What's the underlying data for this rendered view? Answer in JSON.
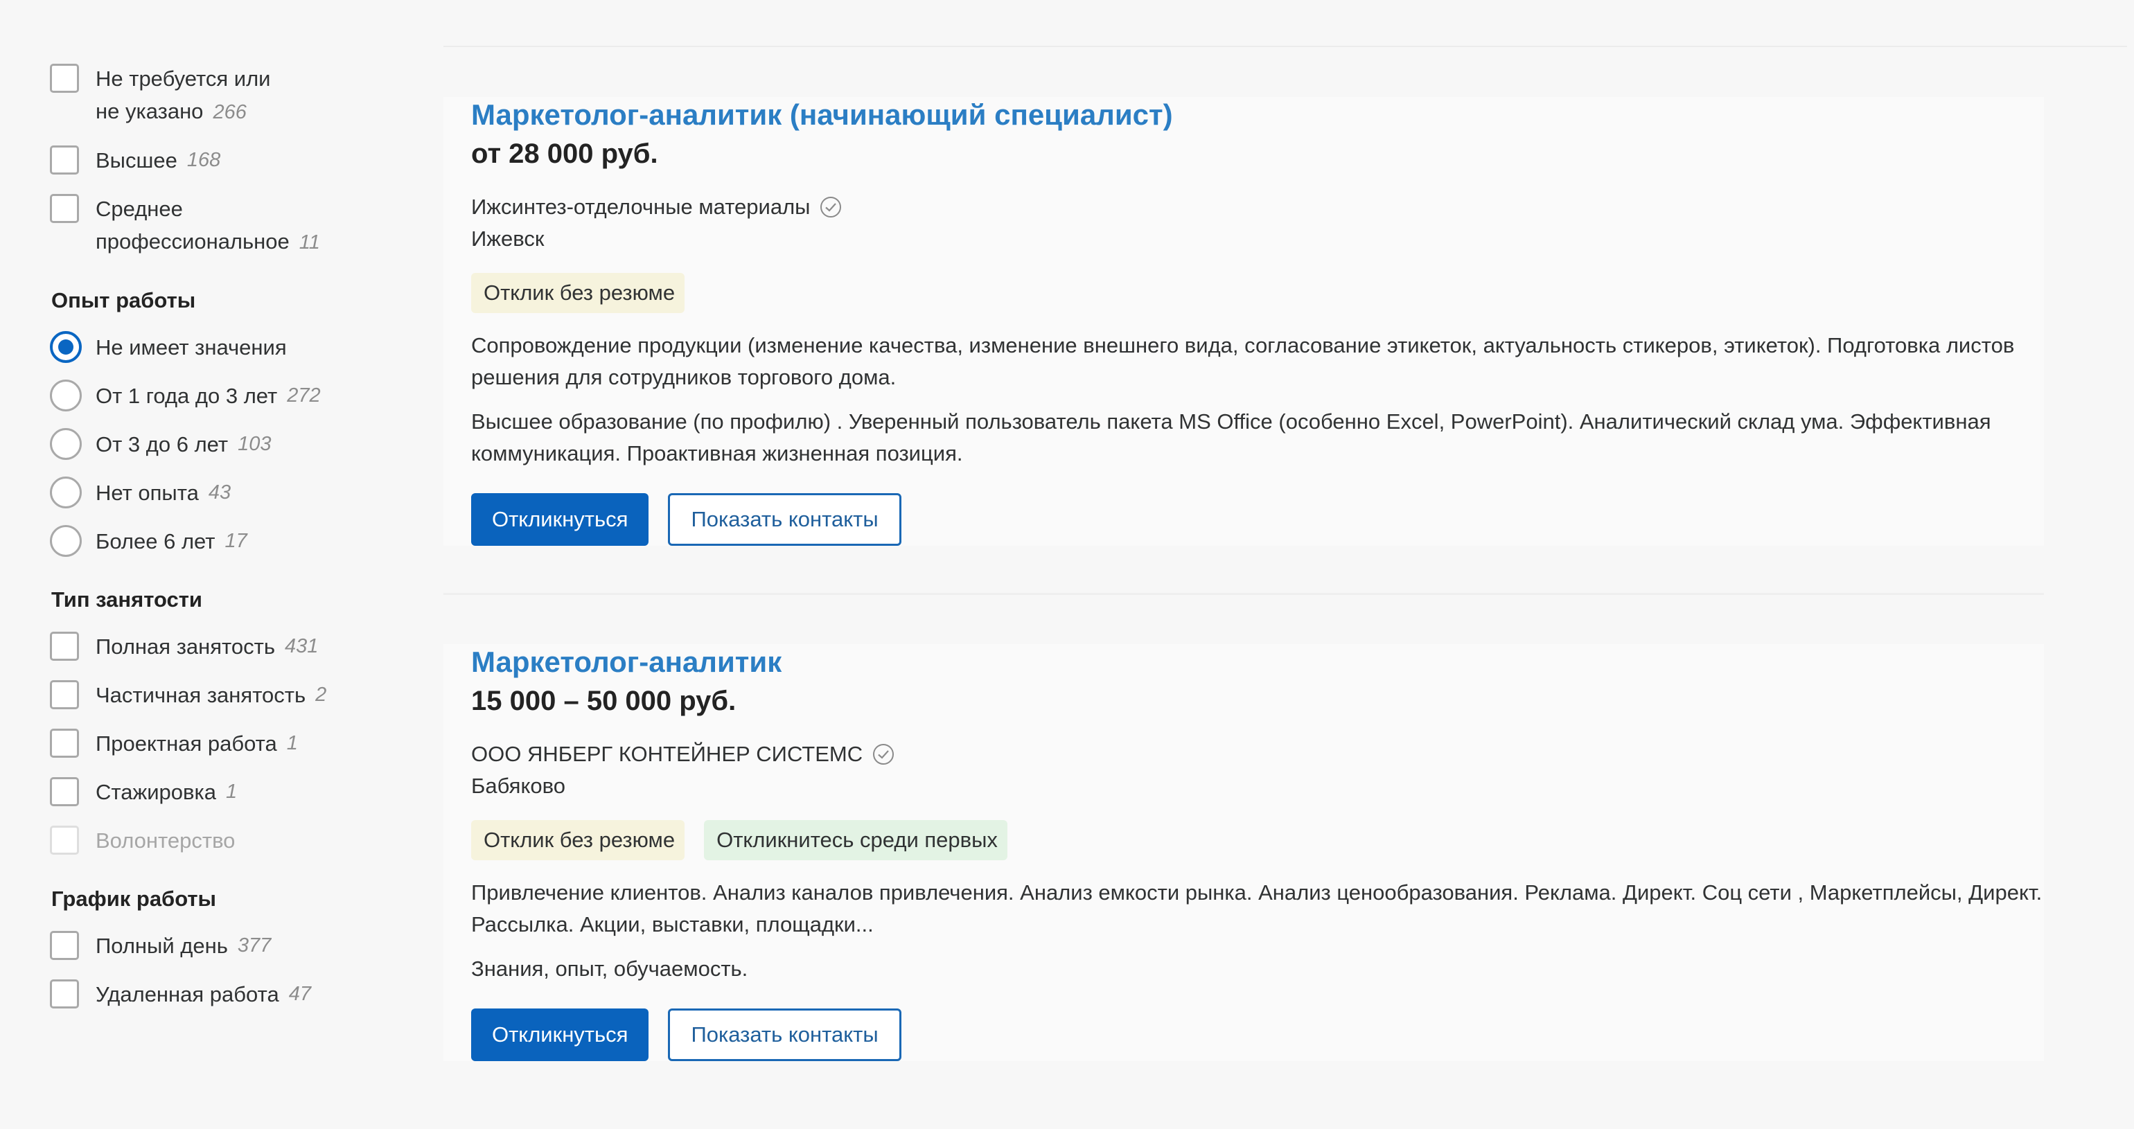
{
  "filters": {
    "education": [
      {
        "label": "Не требуется или не указано",
        "count": "266"
      },
      {
        "label": "Высшее",
        "count": "168"
      },
      {
        "label": "Среднее профессиональное",
        "count": "11"
      }
    ],
    "experience_title": "Опыт работы",
    "experience": [
      {
        "label": "Не имеет значения",
        "count": ""
      },
      {
        "label": "От 1 года до 3 лет",
        "count": "272"
      },
      {
        "label": "От 3 до 6 лет",
        "count": "103"
      },
      {
        "label": "Нет опыта",
        "count": "43"
      },
      {
        "label": "Более 6 лет",
        "count": "17"
      }
    ],
    "employment_title": "Тип занятости",
    "employment": [
      {
        "label": "Полная занятость",
        "count": "431"
      },
      {
        "label": "Частичная занятость",
        "count": "2"
      },
      {
        "label": "Проектная работа",
        "count": "1"
      },
      {
        "label": "Стажировка",
        "count": "1"
      },
      {
        "label": "Волонтерство",
        "count": ""
      }
    ],
    "schedule_title": "График работы",
    "schedule": [
      {
        "label": "Полный день",
        "count": "377"
      },
      {
        "label": "Удаленная работа",
        "count": "47"
      }
    ]
  },
  "vacancies": [
    {
      "title": "Маркетолог-аналитик (начинающий специалист)",
      "salary": "от 28 000 руб.",
      "company": "Ижсинтез-отделочные материалы",
      "city": "Ижевск",
      "tags": [
        "Отклик без резюме"
      ],
      "desc1": "Сопровождение продукции (изменение качества, изменение внешнего вида, согласование этикеток, актуальность стикеров, этикеток). Подготовка листов решения для сотрудников торгового дома.",
      "desc2": "Высшее образование (по профилю) . Уверенный пользователь пакета MS Office (особенно Excel, PowerPoint). Аналитический склад ума. Эффективная коммуникация. Проактивная жизненная позиция.",
      "respond": "Откликнуться",
      "contacts": "Показать контакты"
    },
    {
      "title": "Маркетолог-аналитик",
      "salary": "15 000 – 50 000 руб.",
      "company": "ООО ЯНБЕРГ КОНТЕЙНЕР СИСТЕМС",
      "city": "Бабяково",
      "tags": [
        "Отклик без резюме",
        "Откликнитесь среди первых"
      ],
      "desc1": "Привлечение клиентов. Анализ каналов привлечения. Анализ емкости рынка. Анализ ценообразования. Реклама. Директ. Соц сети , Маркетплейсы, Директ. Рассылка. Акции, выставки, площадки...",
      "desc2": "Знания, опыт, обучаемость.",
      "respond": "Откликнуться",
      "contacts": "Показать контакты"
    }
  ]
}
